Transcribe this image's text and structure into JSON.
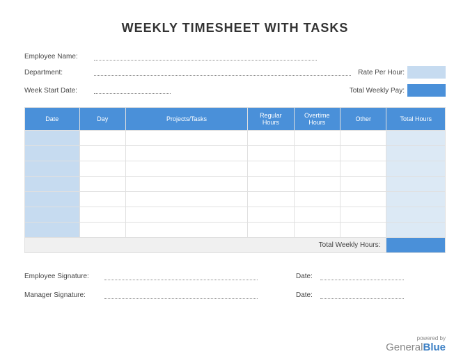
{
  "title": "WEEKLY TIMESHEET WITH TASKS",
  "info": {
    "employee_name_label": "Employee Name:",
    "department_label": "Department:",
    "week_start_label": "Week Start Date:",
    "rate_label": "Rate Per Hour:",
    "pay_label": "Total Weekly Pay:"
  },
  "table": {
    "headers": {
      "date": "Date",
      "day": "Day",
      "projects": "Projects/Tasks",
      "regular": "Regular Hours",
      "overtime": "Overtime Hours",
      "other": "Other",
      "total": "Total Hours"
    },
    "total_label": "Total Weekly Hours:"
  },
  "signatures": {
    "employee_label": "Employee Signature:",
    "manager_label": "Manager Signature:",
    "date_label": "Date:"
  },
  "footer": {
    "powered": "powered by",
    "brand_general": "General",
    "brand_blue": "Blue"
  }
}
